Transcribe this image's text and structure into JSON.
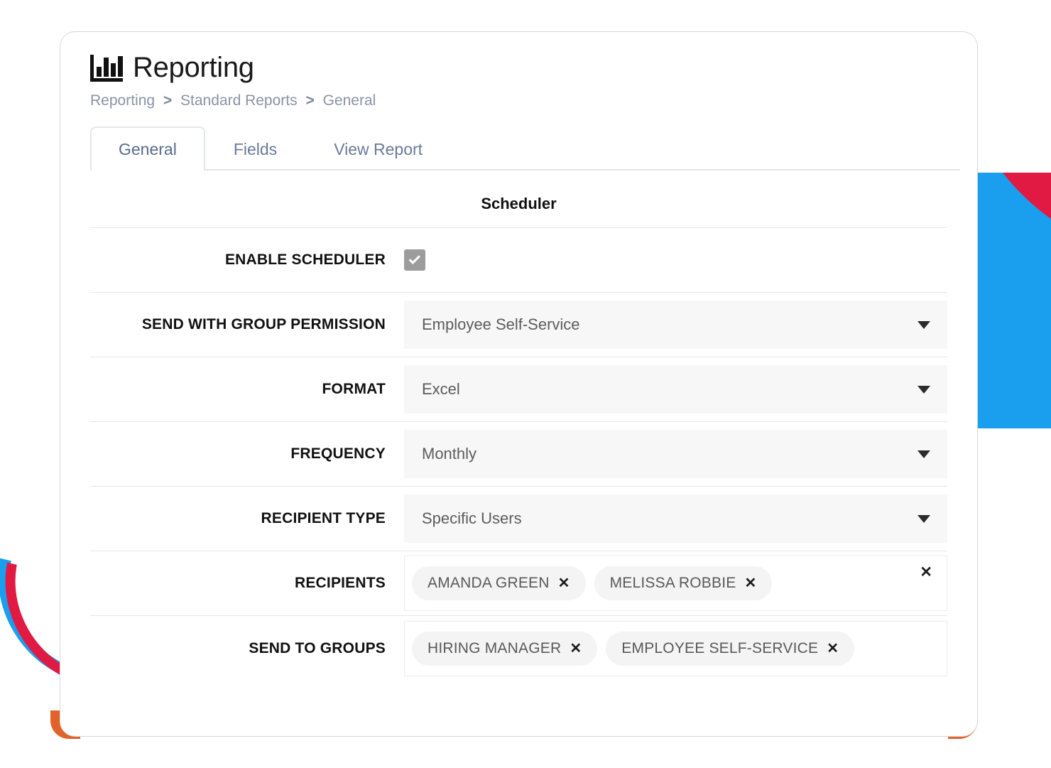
{
  "header": {
    "icon": "bar-chart-icon",
    "title": "Reporting"
  },
  "breadcrumb": {
    "items": [
      "Reporting",
      "Standard Reports",
      "General"
    ],
    "separator": ">"
  },
  "tabs": [
    {
      "label": "General",
      "active": true
    },
    {
      "label": "Fields",
      "active": false
    },
    {
      "label": "View Report",
      "active": false
    }
  ],
  "section": {
    "title": "Scheduler"
  },
  "form": {
    "enable_scheduler": {
      "label": "ENABLE SCHEDULER",
      "checked": true,
      "icon": "checkmark-icon"
    },
    "send_with_group_permission": {
      "label": "SEND WITH GROUP PERMISSION",
      "value": "Employee Self-Service",
      "caret": "chevron-down-icon"
    },
    "format": {
      "label": "FORMAT",
      "value": "Excel",
      "caret": "chevron-down-icon"
    },
    "frequency": {
      "label": "FREQUENCY",
      "value": "Monthly",
      "caret": "chevron-down-icon"
    },
    "recipient_type": {
      "label": "RECIPIENT TYPE",
      "value": "Specific Users",
      "caret": "chevron-down-icon"
    },
    "recipients": {
      "label": "RECIPIENTS",
      "chips": [
        "AMANDA GREEN",
        "MELISSA ROBBIE"
      ],
      "remove_glyph": "✕",
      "clear_all_glyph": "✕"
    },
    "send_to_groups": {
      "label": "SEND TO GROUPS",
      "chips": [
        "HIRING MANAGER",
        "EMPLOYEE SELF-SERVICE"
      ],
      "remove_glyph": "✕"
    }
  },
  "colors": {
    "accent_blue": "#199fee",
    "accent_red": "#e01a43",
    "accent_orange": "#e2622a",
    "tab_text": "#6b7a99",
    "breadcrumb_text": "#8b93a4",
    "field_bg": "#f7f7f7",
    "chip_bg": "#f4f4f4",
    "checkbox_bg": "#9c9c9c"
  }
}
